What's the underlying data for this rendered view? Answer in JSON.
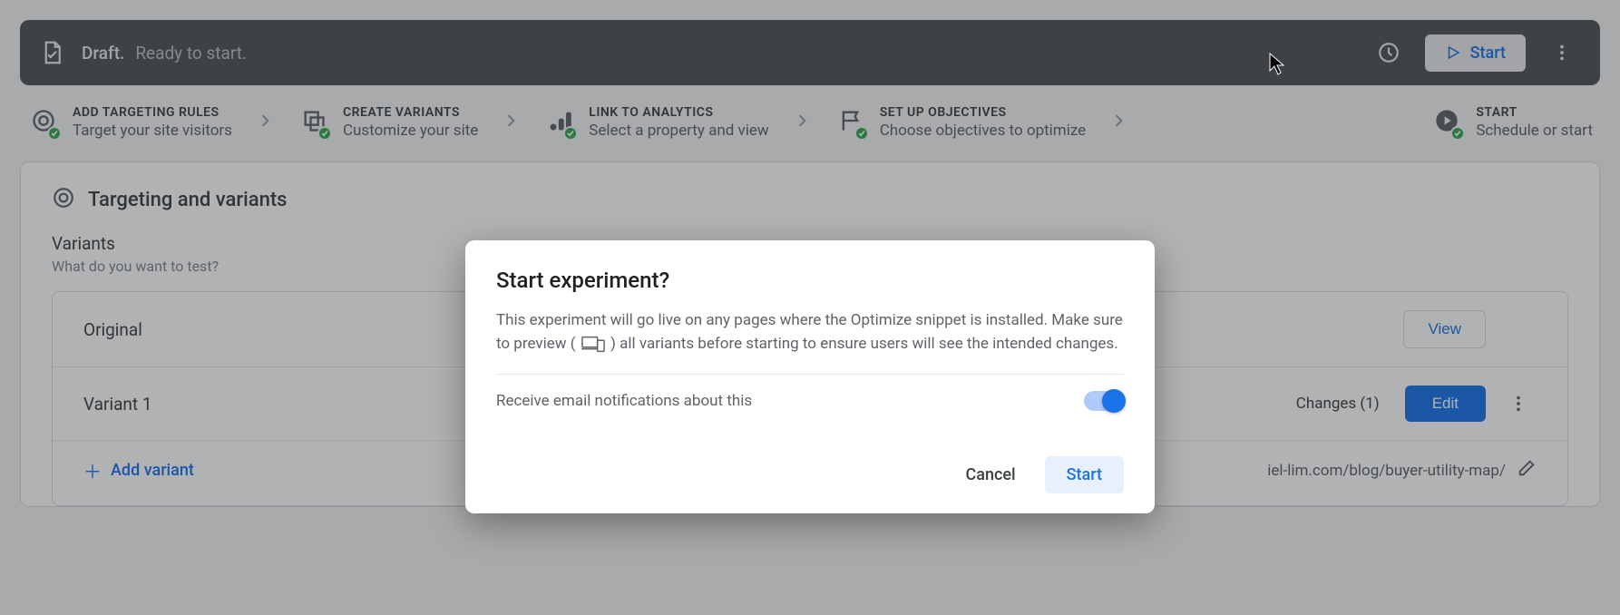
{
  "topbar": {
    "draft_label": "Draft.",
    "ready_label": "Ready to start.",
    "start_label": "Start"
  },
  "stepper": {
    "steps": [
      {
        "title": "ADD TARGETING RULES",
        "sub": "Target your site visitors"
      },
      {
        "title": "CREATE VARIANTS",
        "sub": "Customize your site"
      },
      {
        "title": "LINK TO ANALYTICS",
        "sub": "Select a property and view"
      },
      {
        "title": "SET UP OBJECTIVES",
        "sub": "Choose objectives to optimize"
      },
      {
        "title": "START",
        "sub": "Schedule or start"
      }
    ]
  },
  "panel": {
    "title": "Targeting and variants",
    "variants_heading": "Variants",
    "variants_sub": "What do you want to test?",
    "rows": {
      "original": {
        "name": "Original",
        "view_label": "View"
      },
      "variant1": {
        "name": "Variant 1",
        "changes_label": "Changes (1)",
        "edit_label": "Edit"
      }
    },
    "add_variant_label": "Add variant",
    "editor_url": "iel-lim.com/blog/buyer-utility-map/"
  },
  "dialog": {
    "title": "Start experiment?",
    "body_pre": "This experiment will go live on any pages where the Optimize snippet is installed. Make sure to preview ( ",
    "body_post": " ) all variants before starting to ensure users will see the intended changes.",
    "notif_label": "Receive email notifications about this",
    "cancel_label": "Cancel",
    "start_label": "Start",
    "toggle_on": true
  }
}
